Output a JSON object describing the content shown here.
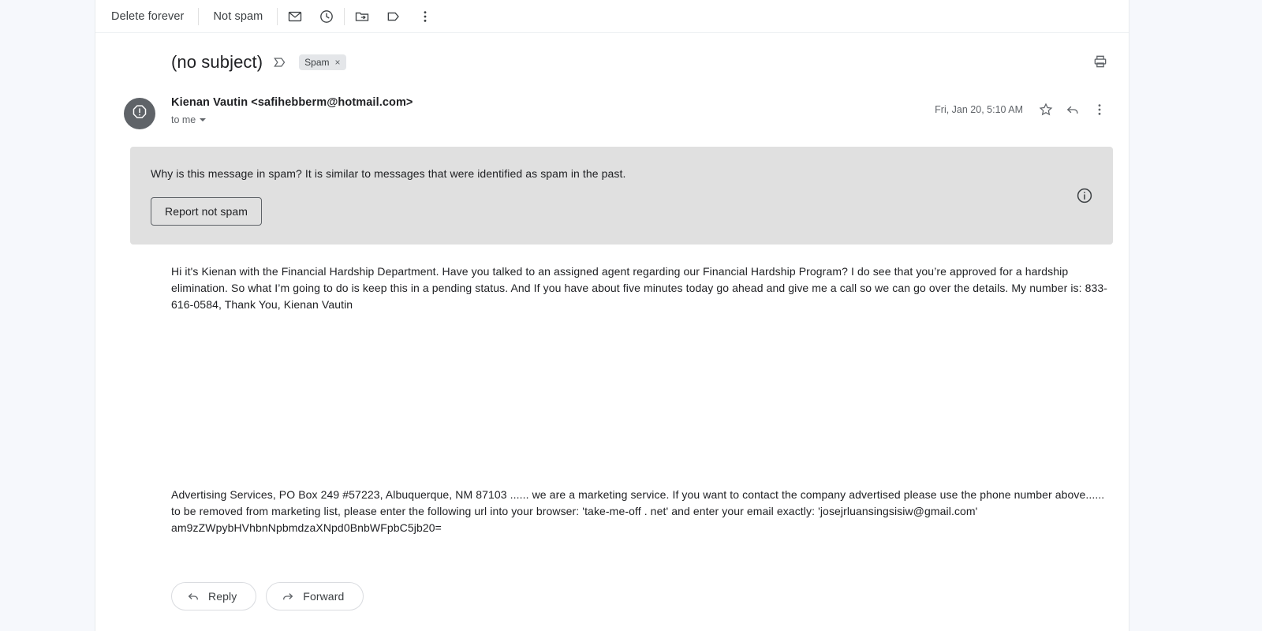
{
  "toolbar": {
    "delete_forever_label": "Delete forever",
    "not_spam_label": "Not spam",
    "icons": {
      "mark_unread": "envelope-icon",
      "snooze": "clock-icon",
      "move_to": "move-to-folder-icon",
      "labels": "label-icon",
      "more": "more-options-icon"
    }
  },
  "thread": {
    "subject": "(no subject)",
    "label_icon": "label-icon",
    "chip_label": "Spam",
    "chip_remove": "×",
    "print_icon": "print-icon"
  },
  "message": {
    "avatar_icon": "warning-octagon-icon",
    "sender": "Kienan Vautin <safihebberm@hotmail.com>",
    "recipient": "to me",
    "date": "Fri, Jan 20, 5:10 AM",
    "star_icon": "star-icon",
    "reply_icon": "reply-arrow-icon",
    "more_icon": "more-options-icon"
  },
  "spam_banner": {
    "text": "Why is this message in spam? It is similar to messages that were identified as spam in the past.",
    "report_button": "Report not spam",
    "info_icon": "info-icon",
    "background_color": "#e0e0e0"
  },
  "body": {
    "paragraph": "Hi it's Kienan with the Financial Hardship Department. Have you talked to an assigned agent regarding our Financial Hardship Program? I do see that you’re approved for a hardship elimination. So what I’m going to do is keep this in a pending status. And If you have about five minutes today go ahead and give me a call so we can go over the details. My number is: 833-616-0584, Thank You, Kienan Vautin",
    "footer": "Advertising Services, PO Box 249 #57223, Albuquerque, NM 87103 ...... we are a marketing service. If you want to contact the company advertised please use the phone number above...... to be removed from marketing list, please enter the following url into your browser: 'take-me-off . net' and enter your email exactly: 'josejrluansingsisiw@gmail.com' am9zZWpybHVhbnNpbmdzaXNpd0BnbWFpbC5jb20="
  },
  "actions": {
    "reply_label": "Reply",
    "forward_label": "Forward"
  }
}
